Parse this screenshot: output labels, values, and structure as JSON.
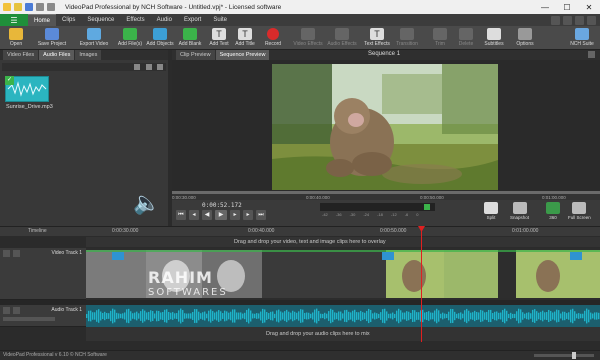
{
  "window": {
    "title": "VideoPad Professional by NCH Software - Untitled.vpj* - Licensed software",
    "controls": [
      "—",
      "☐",
      "✕"
    ]
  },
  "menu": {
    "items": [
      "Home",
      "Clips",
      "Sequence",
      "Effects",
      "Audio",
      "Export",
      "Suite"
    ],
    "active": "Home"
  },
  "toolbar": {
    "open": "Open",
    "save_project": "Save Project",
    "export_video": "Export Video",
    "add_files": "Add File(s)",
    "add_objects": "Add Objects",
    "add_blank": "Add Blank",
    "add_text": "Add Text",
    "add_title": "Add Title",
    "record": "Record",
    "video_effects": "Video Effects",
    "audio_effects": "Audio Effects",
    "text_effects": "Text Effects",
    "transition": "Transition",
    "trim": "Trim",
    "delete": "Delete",
    "subtitles": "Subtitles",
    "options": "Options",
    "nch_suite": "NCH Suite"
  },
  "bin": {
    "tabs": [
      "Video Files",
      "Audio Files",
      "Images"
    ],
    "active_tab": "Audio Files",
    "clip_name": "Sunrise_Drive.mp3"
  },
  "preview": {
    "tabs": [
      "Clip Preview",
      "Sequence Preview"
    ],
    "active_tab": "Sequence Preview",
    "title": "Sequence 1",
    "ruler_ticks": [
      "0:00:30.000",
      "0:00:40.000",
      "0:00:50.000",
      "0:01:00.000"
    ],
    "timecode": "0:00:52.172",
    "meter_scale": [
      "-42",
      "-36",
      "-30",
      "-24",
      "-18",
      "-12",
      "-6",
      "0"
    ],
    "buttons": {
      "split": "Split",
      "snapshot": "Snapshot",
      "three_sixty": "360",
      "full_screen": "Full Screen"
    }
  },
  "timeline": {
    "label": "Timeline",
    "ticks": [
      "0:00:30.000",
      "0:00:40.000",
      "0:00:50.000",
      "0:01:00.000"
    ],
    "overlay_hint": "Drag and drop your video, text and image clips here to overlay",
    "audio_hint": "Drag and drop your audio clips here to mix",
    "video_track": "Video Track 1",
    "audio_track": "Audio Track 1"
  },
  "watermark": {
    "line1": "RAHIM",
    "line2": "SOFTWARES"
  },
  "status": "VideoPad Professional v 6.10 © NCH Software",
  "colors": {
    "accent": "#1f8f3a",
    "clip": "#2bb5c0",
    "playhead": "#e02020",
    "waveform": "#1fb3c9"
  }
}
